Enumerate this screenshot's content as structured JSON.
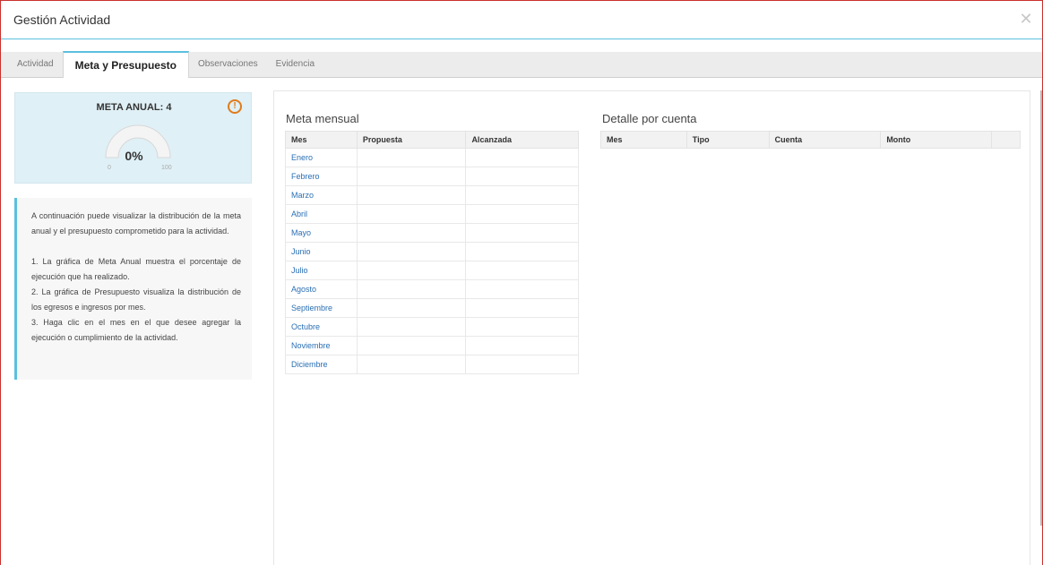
{
  "window": {
    "title": "Gestión Actividad",
    "close_icon": "close-icon"
  },
  "tabs": [
    {
      "label": "Actividad",
      "active": false
    },
    {
      "label": "Meta y Presupuesto",
      "active": true
    },
    {
      "label": "Observaciones",
      "active": false
    },
    {
      "label": "Evidencia",
      "active": false
    }
  ],
  "meta_anual": {
    "title": "META ANUAL: 4",
    "info_icon": "info-icon",
    "gauge": {
      "value_label": "0%",
      "value": 0,
      "min": "0",
      "max": "100"
    }
  },
  "help": {
    "intro": "A continuación puede visualizar la distribución de la meta anual y el presupuesto comprometido para la actividad.",
    "items": [
      "1. La gráfica de Meta Anual muestra el porcentaje de ejecución que ha realizado.",
      "2. La gráfica de Presupuesto visualiza la distribución de los egresos e ingresos por mes.",
      "3. Haga clic en el mes en el que desee agregar la ejecución o cumplimiento de la actividad."
    ]
  },
  "meta_mensual": {
    "title": "Meta mensual",
    "columns": [
      "Mes",
      "Propuesta",
      "Alcanzada"
    ],
    "months": [
      "Enero",
      "Febrero",
      "Marzo",
      "Abril",
      "Mayo",
      "Junio",
      "Julio",
      "Agosto",
      "Septiembre",
      "Octubre",
      "Noviembre",
      "Diciembre"
    ]
  },
  "detalle_cuenta": {
    "title": "Detalle por cuenta",
    "columns": [
      "Mes",
      "Tipo",
      "Cuenta",
      "Monto",
      ""
    ]
  },
  "colors": {
    "accent": "#5bc0de",
    "border_red": "#c9302c",
    "link": "#2a6fb4",
    "info": "#e07b1a"
  }
}
